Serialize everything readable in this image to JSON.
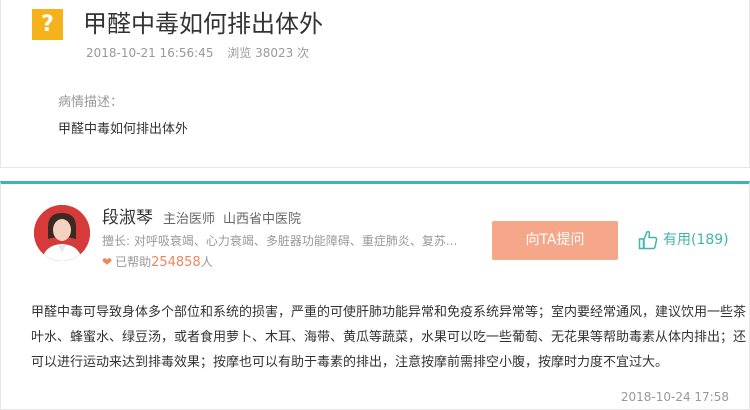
{
  "question": {
    "badge": "?",
    "title": "甲醛中毒如何排出体外",
    "date": "2018-10-21 16:56:45",
    "views": "浏览 38023 次",
    "desc_label": "病情描述：",
    "desc_text": "甲醛中毒如何排出体外"
  },
  "doctor": {
    "name": "段淑琴",
    "title": "主治医师",
    "hospital": "山西省中医院",
    "specialty": "擅长: 对呼吸衰竭、心力衰竭、多脏器功能障碍、重症肺炎、复苏...",
    "helped_prefix": "已帮助",
    "helped_count": "254858",
    "helped_suffix": "人",
    "ask_label": "向TA提问",
    "useful_label": "有用(189)"
  },
  "answer": {
    "lines": [
      "甲醛中毒可导致身体多个部位和系统的损害，严重的可使肝肺功能异常和免疫系统异常等；室内要经常通风，建议饮用一些茶",
      "叶水、蜂蜜水、绿豆汤，或者食用萝卜、木耳、海带、黄瓜等蔬菜，水果可以吃一些葡萄、无花果等帮助毒素从体内排出；还",
      "可以进行运动来达到排毒效果；按摩也可以有助于毒素的排出，注意按摩前需排空小腹，按摩时力度不宜过大。"
    ],
    "time": "2018-10-24 17:58"
  },
  "colors": {
    "accent": "#3fb5ad",
    "badge": "#f5b21a",
    "button": "#f6a689",
    "helped": "#f0855b"
  }
}
